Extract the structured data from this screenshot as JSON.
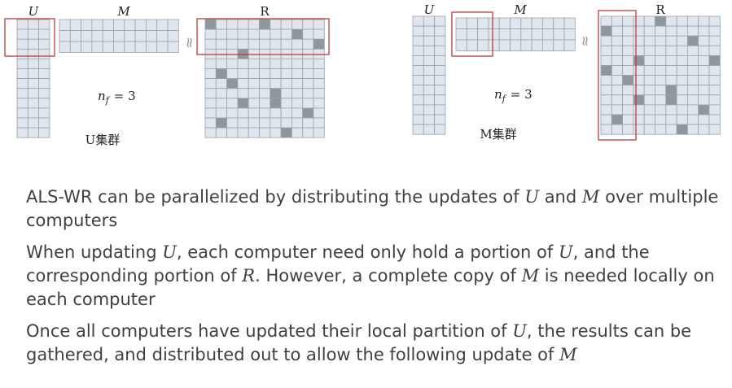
{
  "diagrams": [
    {
      "name": "u-cluster",
      "labels": {
        "u": "U",
        "m": "M",
        "r": "R"
      },
      "nf_text": "= 3",
      "cluster_label": "U集群"
    },
    {
      "name": "m-cluster",
      "labels": {
        "u": "U",
        "m": "M",
        "r": "R"
      },
      "nf_text": "= 3",
      "cluster_label": "M集群"
    }
  ],
  "approx_symbol": "≈",
  "paragraphs": [
    [
      {
        "t": "ALS-WR can be parallelized by distributing the updates of "
      },
      {
        "t": "U",
        "v": true
      },
      {
        "t": " and "
      },
      {
        "t": "M",
        "v": true
      },
      {
        "t": " over multiple computers"
      }
    ],
    [
      {
        "t": "When updating "
      },
      {
        "t": "U",
        "v": true
      },
      {
        "t": ", each computer need only hold a portion of "
      },
      {
        "t": "U",
        "v": true
      },
      {
        "t": ", and the corresponding portion of "
      },
      {
        "t": "R",
        "v": true
      },
      {
        "t": ".  However, a complete copy of "
      },
      {
        "t": "M",
        "v": true
      },
      {
        "t": " is needed locally on each computer"
      }
    ],
    [
      {
        "t": "Once all computers have updated their local partition of "
      },
      {
        "t": "U",
        "v": true
      },
      {
        "t": ", the results can be gathered, and distributed out to allow the following update of "
      },
      {
        "t": "M",
        "v": true
      }
    ]
  ],
  "colors": {
    "cell_fill": "#dfe6ee",
    "cell_stroke": "#9aa3ad",
    "dark_cell": "#8e969e",
    "highlight_box": "#c0393b",
    "text": "#404040"
  }
}
